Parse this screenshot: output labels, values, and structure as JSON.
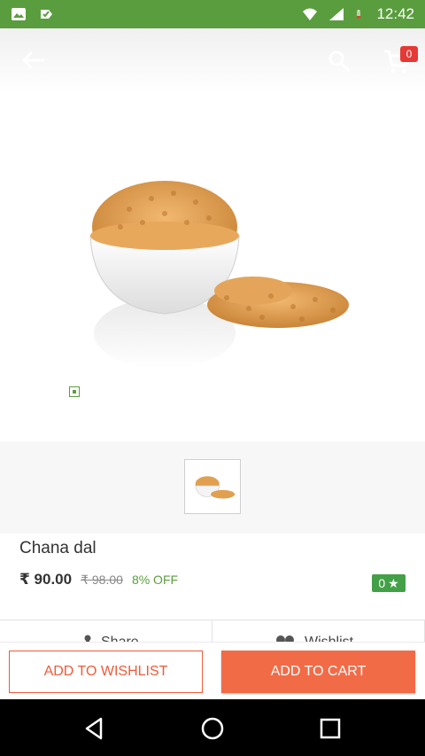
{
  "status_bar": {
    "time": "12:42",
    "left_icons": [
      "image-icon",
      "check-bag-icon"
    ],
    "right_icons": [
      "wifi-icon",
      "signal-icon",
      "battery-icon"
    ]
  },
  "top_bar": {
    "cart_count": "0",
    "icons": [
      "back-arrow-icon",
      "search-icon",
      "cart-icon"
    ]
  },
  "product": {
    "name": "Chana dal",
    "price": "₹ 90.00",
    "mrp": "₹ 98.00",
    "discount": "8% OFF",
    "rating": "0",
    "rating_icon": "star-icon"
  },
  "tabs": [
    "Share",
    "Wishlist"
  ],
  "actions": {
    "wishlist_label": "ADD TO WISHLIST",
    "cart_label": "ADD TO CART"
  },
  "colors": {
    "status_bar": "#5a9d3e",
    "accent": "#f26b47",
    "rating_badge": "#43a047",
    "cart_badge": "#e53935"
  }
}
